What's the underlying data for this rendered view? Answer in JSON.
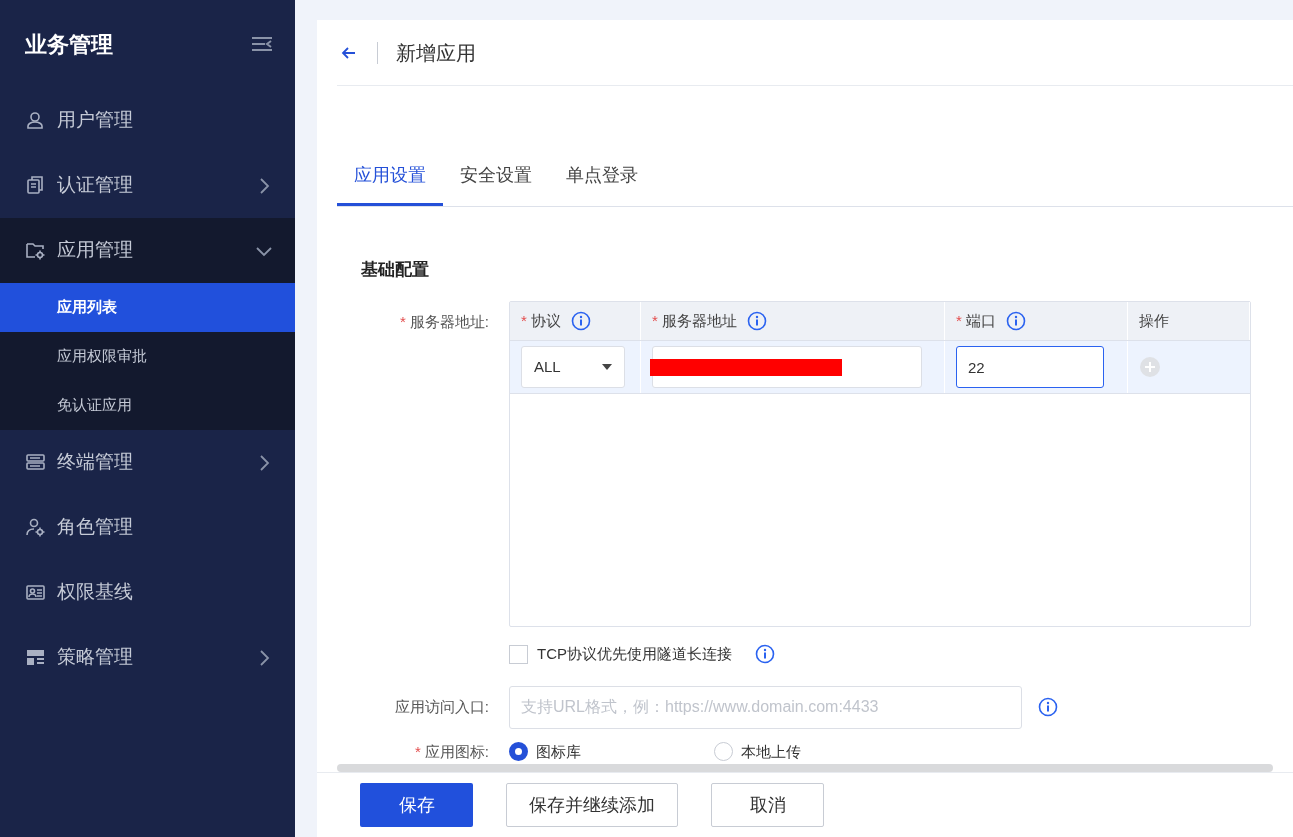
{
  "sidebar": {
    "title": "业务管理",
    "items": [
      {
        "label": "用户管理",
        "kind": "user"
      },
      {
        "label": "认证管理",
        "kind": "document",
        "expanded": false
      },
      {
        "label": "应用管理",
        "kind": "folder",
        "expanded": true,
        "children": [
          {
            "label": "应用列表",
            "selected": true
          },
          {
            "label": "应用权限审批",
            "selected": false
          },
          {
            "label": "免认证应用",
            "selected": false
          }
        ]
      },
      {
        "label": "终端管理",
        "kind": "server",
        "expanded": false
      },
      {
        "label": "角色管理",
        "kind": "role"
      },
      {
        "label": "权限基线",
        "kind": "card"
      },
      {
        "label": "策略管理",
        "kind": "layout",
        "expanded": false
      }
    ]
  },
  "page_title": "新增应用",
  "tabs": [
    {
      "label": "应用设置",
      "selected": true
    },
    {
      "label": "安全设置",
      "selected": false
    },
    {
      "label": "单点登录",
      "selected": false
    }
  ],
  "section_title": "基础配置",
  "server_field": {
    "required_mark": "*",
    "label": "服务器地址:",
    "columns": [
      {
        "required_mark": "*",
        "label": "协议",
        "info": true
      },
      {
        "required_mark": "*",
        "label": "服务器地址",
        "info": true
      },
      {
        "required_mark": "*",
        "label": "端口",
        "info": true
      },
      {
        "label": "操作",
        "info": false
      }
    ],
    "rows": [
      {
        "protocol": "ALL",
        "address_redacted": true,
        "port": "22"
      }
    ]
  },
  "tcp_option": {
    "label": "TCP协议优先使用隧道长连接",
    "checked": false
  },
  "entry_field": {
    "label": "应用访问入口:",
    "placeholder": "支持URL格式，例：https://www.domain.com:4433"
  },
  "icon_field": {
    "required_mark": "*",
    "label": "应用图标:",
    "options": [
      {
        "label": "图标库",
        "selected": true
      },
      {
        "label": "本地上传",
        "selected": false
      }
    ]
  },
  "buttons": [
    {
      "label": "保存",
      "kind": "primary"
    },
    {
      "label": "保存并继续添加",
      "kind": "default"
    },
    {
      "label": "取消",
      "kind": "default"
    }
  ]
}
